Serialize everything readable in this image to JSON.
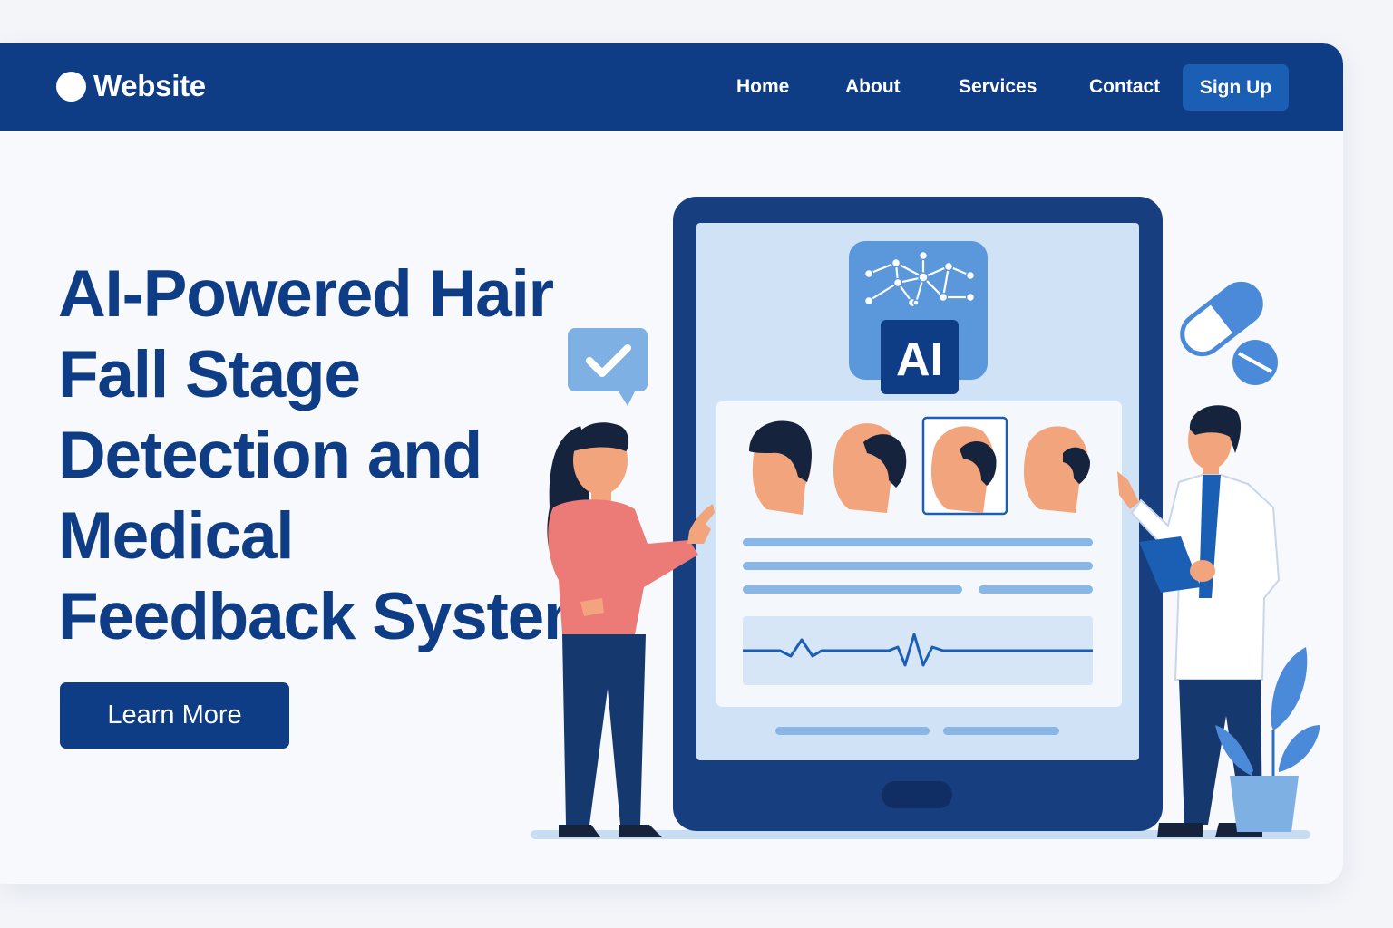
{
  "nav": {
    "brand": "Website",
    "links": [
      "Home",
      "About",
      "Services",
      "Contact"
    ],
    "signup_label": "Sign Up"
  },
  "hero": {
    "title": "AI-Powered Hair Fall Stage Detection and Medical Feedback System",
    "cta_label": "Learn More"
  },
  "illustration": {
    "badge_text": "AI"
  },
  "colors": {
    "navy": "#0e3d86",
    "accent_blue": "#1a5fb4",
    "light_blue": "#cfe2f6",
    "background": "#f7f9fc"
  }
}
